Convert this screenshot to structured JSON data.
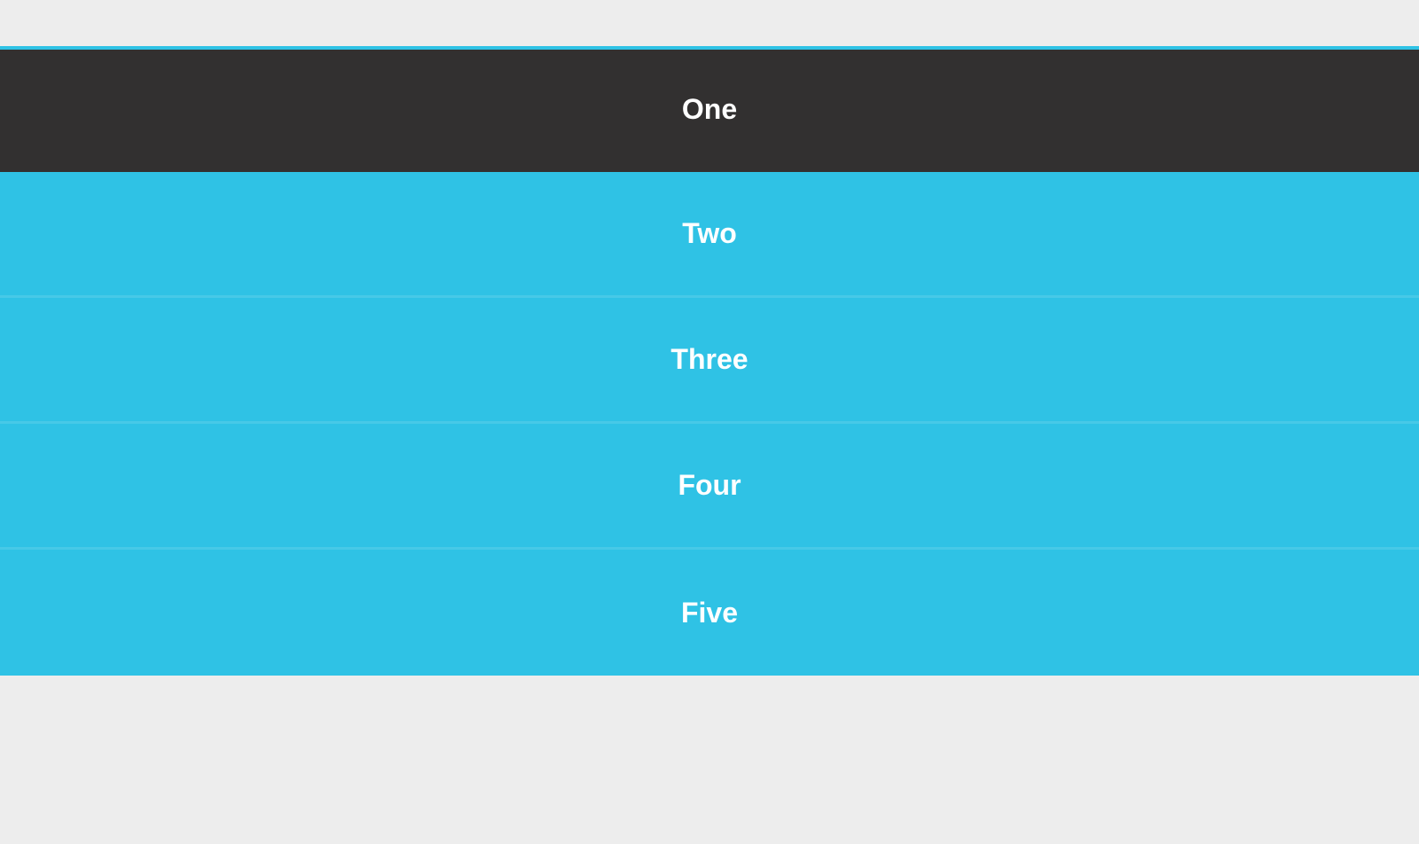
{
  "menu": {
    "items": [
      {
        "label": "One",
        "active": true
      },
      {
        "label": "Two",
        "active": false
      },
      {
        "label": "Three",
        "active": false
      },
      {
        "label": "Four",
        "active": false
      },
      {
        "label": "Five",
        "active": false
      }
    ]
  },
  "colors": {
    "background": "#ededed",
    "item_bg": "#2fc2e5",
    "item_active_bg": "#323030",
    "text": "#ffffff"
  }
}
